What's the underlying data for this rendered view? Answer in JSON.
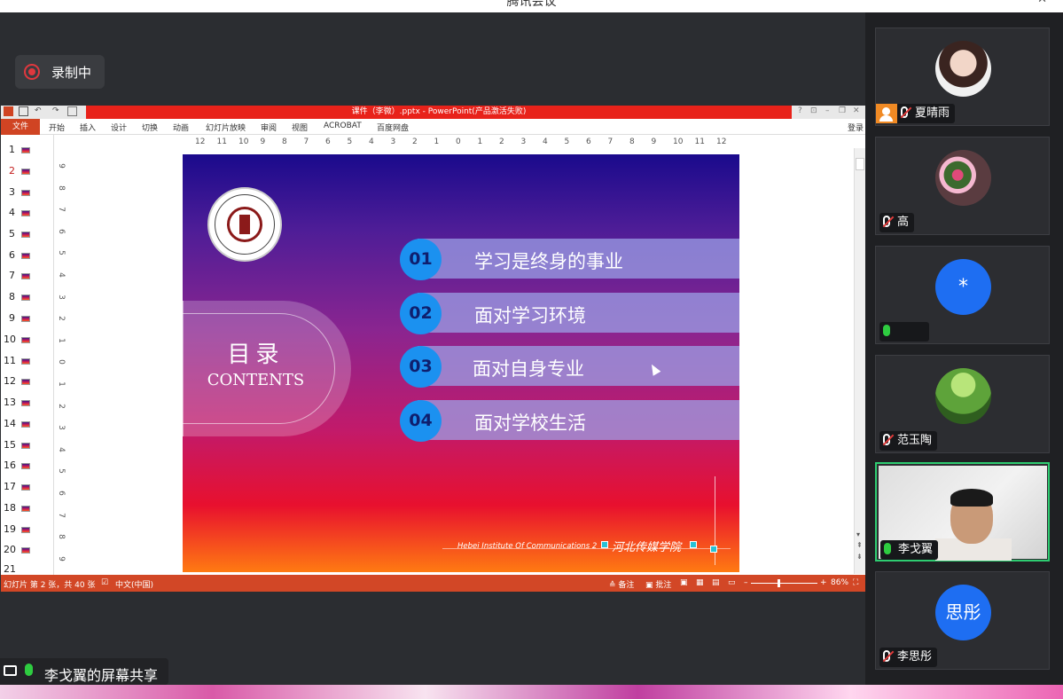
{
  "app": {
    "title": "腾讯会议",
    "recording_label": "录制中",
    "share_label": "李戈翼的屏幕共享",
    "colors": {
      "accent": "#1e6ef2",
      "mic_on": "#2ecc40",
      "record": "#e0383e",
      "ppt_red": "#d24726"
    }
  },
  "ppt": {
    "title": "课件（李微）.pptx - PowerPoint(产品激活失败)",
    "file_tab": "文件",
    "tabs": [
      "开始",
      "插入",
      "设计",
      "切换",
      "动画",
      "幻灯片放映",
      "审阅",
      "视图",
      "ACROBAT",
      "百度网盘"
    ],
    "login": "登录",
    "window_controls": [
      "?",
      "⊡",
      "–",
      "❐",
      "✕"
    ],
    "slide_numbers": [
      "1",
      "2",
      "3",
      "4",
      "5",
      "6",
      "7",
      "8",
      "9",
      "10",
      "11",
      "12",
      "13",
      "14",
      "15",
      "16",
      "17",
      "18",
      "19",
      "20",
      "21"
    ],
    "selected_slide": "2",
    "hruler": [
      "12",
      "11",
      "10",
      "9",
      "8",
      "7",
      "6",
      "5",
      "4",
      "3",
      "2",
      "1",
      "0",
      "1",
      "2",
      "3",
      "4",
      "5",
      "6",
      "7",
      "8",
      "9",
      "10",
      "11",
      "12"
    ],
    "vruler": [
      "9",
      "8",
      "7",
      "6",
      "5",
      "4",
      "3",
      "2",
      "1",
      "0",
      "1",
      "2",
      "3",
      "4",
      "5",
      "6",
      "7",
      "8",
      "9"
    ],
    "status": {
      "slide_info": "幻灯片 第 2 张，共 40 张",
      "language": "中文(中国)",
      "notes": "备注",
      "comments": "批注",
      "zoom": "86%"
    }
  },
  "slide": {
    "toc_title": "目录",
    "toc_sub": "CONTENTS",
    "items": [
      {
        "num": "01",
        "label": "学习是终身的事业"
      },
      {
        "num": "02",
        "label": "面对学习环境"
      },
      {
        "num": "03",
        "label": "面对自身专业"
      },
      {
        "num": "04",
        "label": "面对学校生活"
      }
    ],
    "footer_en": "Hebei  Institute  Of  Communications 2",
    "footer_cn": "河北传媒学院"
  },
  "participants": [
    {
      "name": "夏晴雨",
      "mic": "off",
      "host": true,
      "avatar": "photo"
    },
    {
      "name": "高",
      "mic": "off",
      "host": false,
      "avatar": "flowers"
    },
    {
      "name": "",
      "mic": "on",
      "host": false,
      "avatar": "initial",
      "initial": "*"
    },
    {
      "name": "范玉陶",
      "mic": "off",
      "host": false,
      "avatar": "nature"
    },
    {
      "name": "李戈翼",
      "mic": "on",
      "host": false,
      "avatar": "video",
      "active": true
    },
    {
      "name": "李思彤",
      "mic": "off",
      "host": false,
      "avatar": "initial",
      "initial": "思彤"
    }
  ]
}
